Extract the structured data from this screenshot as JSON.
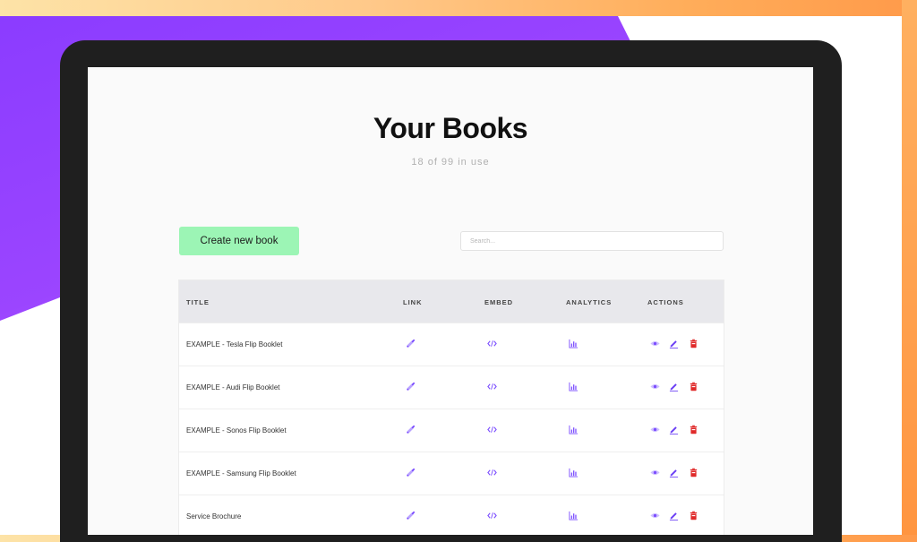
{
  "page": {
    "title": "Your Books",
    "usage": "18 of 99 in use"
  },
  "toolbar": {
    "create_label": "Create new book",
    "search_placeholder": "Search..."
  },
  "table": {
    "headers": {
      "title": "TITLE",
      "link": "LINK",
      "embed": "EMBED",
      "analytics": "ANALYTICS",
      "actions": "ACTIONS"
    },
    "rows": [
      {
        "title": "EXAMPLE - Tesla Flip Booklet"
      },
      {
        "title": "EXAMPLE - Audi Flip Booklet"
      },
      {
        "title": "EXAMPLE - Sonos Flip Booklet"
      },
      {
        "title": "EXAMPLE - Samsung Flip Booklet"
      },
      {
        "title": "Service Brochure"
      }
    ],
    "row_icons": {
      "link": "link-icon",
      "embed": "code-embed-icon",
      "analytics": "bar-chart-icon",
      "view": "eye-icon",
      "edit": "pencil-icon",
      "delete": "trash-icon"
    }
  },
  "colors": {
    "accent_purple": "#7b4dff",
    "create_button": "#9cf5b5",
    "delete_red": "#e02a2a",
    "background_purple": "#8b3cff",
    "background_orange": "#ff9a4a"
  }
}
